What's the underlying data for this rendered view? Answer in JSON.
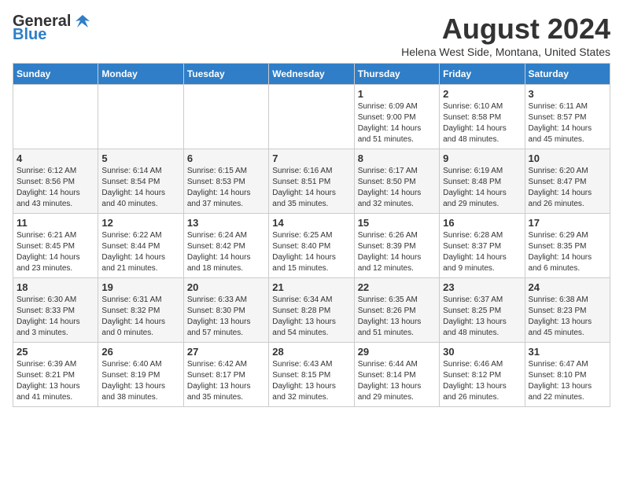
{
  "logo": {
    "general": "General",
    "blue": "Blue"
  },
  "header": {
    "month_year": "August 2024",
    "location": "Helena West Side, Montana, United States"
  },
  "days_of_week": [
    "Sunday",
    "Monday",
    "Tuesday",
    "Wednesday",
    "Thursday",
    "Friday",
    "Saturday"
  ],
  "weeks": [
    [
      {
        "day": "",
        "info": ""
      },
      {
        "day": "",
        "info": ""
      },
      {
        "day": "",
        "info": ""
      },
      {
        "day": "",
        "info": ""
      },
      {
        "day": "1",
        "info": "Sunrise: 6:09 AM\nSunset: 9:00 PM\nDaylight: 14 hours\nand 51 minutes."
      },
      {
        "day": "2",
        "info": "Sunrise: 6:10 AM\nSunset: 8:58 PM\nDaylight: 14 hours\nand 48 minutes."
      },
      {
        "day": "3",
        "info": "Sunrise: 6:11 AM\nSunset: 8:57 PM\nDaylight: 14 hours\nand 45 minutes."
      }
    ],
    [
      {
        "day": "4",
        "info": "Sunrise: 6:12 AM\nSunset: 8:56 PM\nDaylight: 14 hours\nand 43 minutes."
      },
      {
        "day": "5",
        "info": "Sunrise: 6:14 AM\nSunset: 8:54 PM\nDaylight: 14 hours\nand 40 minutes."
      },
      {
        "day": "6",
        "info": "Sunrise: 6:15 AM\nSunset: 8:53 PM\nDaylight: 14 hours\nand 37 minutes."
      },
      {
        "day": "7",
        "info": "Sunrise: 6:16 AM\nSunset: 8:51 PM\nDaylight: 14 hours\nand 35 minutes."
      },
      {
        "day": "8",
        "info": "Sunrise: 6:17 AM\nSunset: 8:50 PM\nDaylight: 14 hours\nand 32 minutes."
      },
      {
        "day": "9",
        "info": "Sunrise: 6:19 AM\nSunset: 8:48 PM\nDaylight: 14 hours\nand 29 minutes."
      },
      {
        "day": "10",
        "info": "Sunrise: 6:20 AM\nSunset: 8:47 PM\nDaylight: 14 hours\nand 26 minutes."
      }
    ],
    [
      {
        "day": "11",
        "info": "Sunrise: 6:21 AM\nSunset: 8:45 PM\nDaylight: 14 hours\nand 23 minutes."
      },
      {
        "day": "12",
        "info": "Sunrise: 6:22 AM\nSunset: 8:44 PM\nDaylight: 14 hours\nand 21 minutes."
      },
      {
        "day": "13",
        "info": "Sunrise: 6:24 AM\nSunset: 8:42 PM\nDaylight: 14 hours\nand 18 minutes."
      },
      {
        "day": "14",
        "info": "Sunrise: 6:25 AM\nSunset: 8:40 PM\nDaylight: 14 hours\nand 15 minutes."
      },
      {
        "day": "15",
        "info": "Sunrise: 6:26 AM\nSunset: 8:39 PM\nDaylight: 14 hours\nand 12 minutes."
      },
      {
        "day": "16",
        "info": "Sunrise: 6:28 AM\nSunset: 8:37 PM\nDaylight: 14 hours\nand 9 minutes."
      },
      {
        "day": "17",
        "info": "Sunrise: 6:29 AM\nSunset: 8:35 PM\nDaylight: 14 hours\nand 6 minutes."
      }
    ],
    [
      {
        "day": "18",
        "info": "Sunrise: 6:30 AM\nSunset: 8:33 PM\nDaylight: 14 hours\nand 3 minutes."
      },
      {
        "day": "19",
        "info": "Sunrise: 6:31 AM\nSunset: 8:32 PM\nDaylight: 14 hours\nand 0 minutes."
      },
      {
        "day": "20",
        "info": "Sunrise: 6:33 AM\nSunset: 8:30 PM\nDaylight: 13 hours\nand 57 minutes."
      },
      {
        "day": "21",
        "info": "Sunrise: 6:34 AM\nSunset: 8:28 PM\nDaylight: 13 hours\nand 54 minutes."
      },
      {
        "day": "22",
        "info": "Sunrise: 6:35 AM\nSunset: 8:26 PM\nDaylight: 13 hours\nand 51 minutes."
      },
      {
        "day": "23",
        "info": "Sunrise: 6:37 AM\nSunset: 8:25 PM\nDaylight: 13 hours\nand 48 minutes."
      },
      {
        "day": "24",
        "info": "Sunrise: 6:38 AM\nSunset: 8:23 PM\nDaylight: 13 hours\nand 45 minutes."
      }
    ],
    [
      {
        "day": "25",
        "info": "Sunrise: 6:39 AM\nSunset: 8:21 PM\nDaylight: 13 hours\nand 41 minutes."
      },
      {
        "day": "26",
        "info": "Sunrise: 6:40 AM\nSunset: 8:19 PM\nDaylight: 13 hours\nand 38 minutes."
      },
      {
        "day": "27",
        "info": "Sunrise: 6:42 AM\nSunset: 8:17 PM\nDaylight: 13 hours\nand 35 minutes."
      },
      {
        "day": "28",
        "info": "Sunrise: 6:43 AM\nSunset: 8:15 PM\nDaylight: 13 hours\nand 32 minutes."
      },
      {
        "day": "29",
        "info": "Sunrise: 6:44 AM\nSunset: 8:14 PM\nDaylight: 13 hours\nand 29 minutes."
      },
      {
        "day": "30",
        "info": "Sunrise: 6:46 AM\nSunset: 8:12 PM\nDaylight: 13 hours\nand 26 minutes."
      },
      {
        "day": "31",
        "info": "Sunrise: 6:47 AM\nSunset: 8:10 PM\nDaylight: 13 hours\nand 22 minutes."
      }
    ]
  ]
}
